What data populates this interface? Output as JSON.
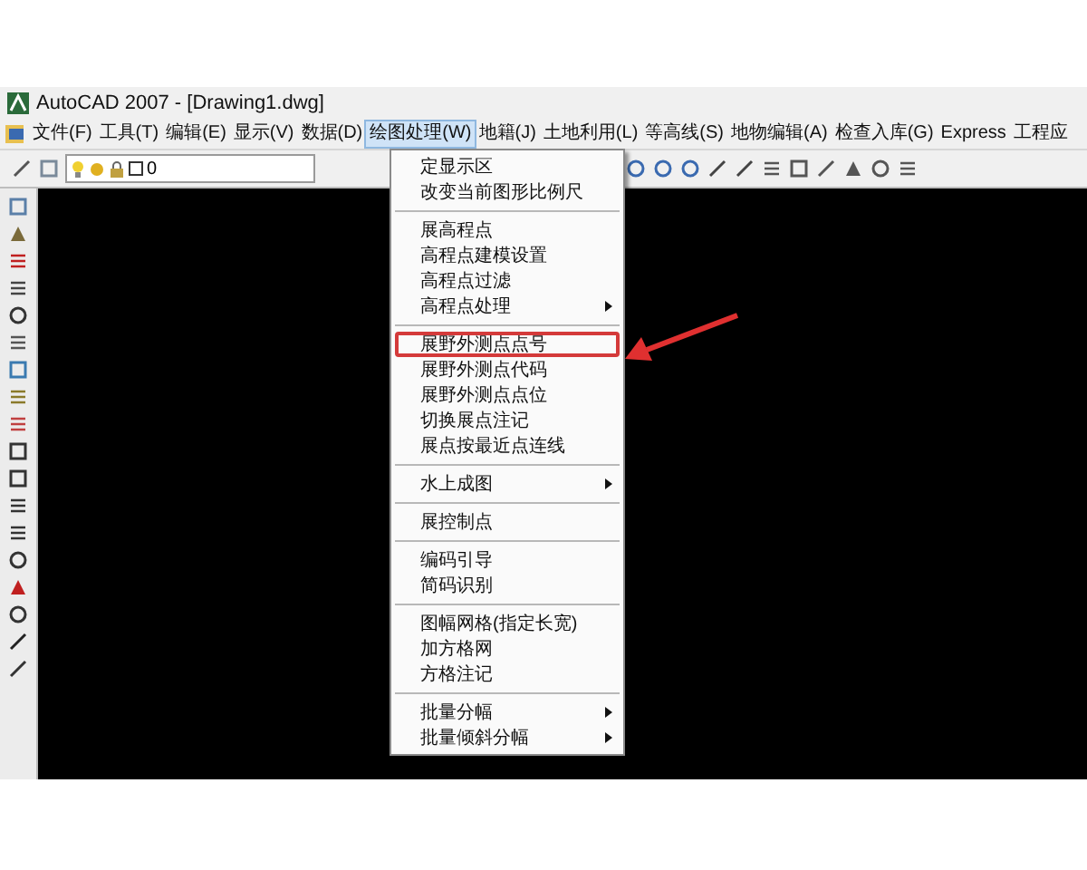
{
  "window": {
    "title": "AutoCAD 2007 - [Drawing1.dwg]"
  },
  "menu_bar": [
    {
      "label": "文件(F)",
      "selected": false
    },
    {
      "label": "工具(T)",
      "selected": false
    },
    {
      "label": "编辑(E)",
      "selected": false
    },
    {
      "label": "显示(V)",
      "selected": false
    },
    {
      "label": "数据(D)",
      "selected": false
    },
    {
      "label": "绘图处理(W)",
      "selected": true
    },
    {
      "label": "地籍(J)",
      "selected": false
    },
    {
      "label": "土地利用(L)",
      "selected": false
    },
    {
      "label": "等高线(S)",
      "selected": false
    },
    {
      "label": "地物编辑(A)",
      "selected": false
    },
    {
      "label": "检查入库(G)",
      "selected": false
    },
    {
      "label": "Express",
      "selected": false
    },
    {
      "label": "工程应",
      "selected": false
    }
  ],
  "layer_dropdown": {
    "value": "0"
  },
  "dropdown_menu": [
    {
      "kind": "item",
      "label": "定显示区",
      "submenu": false,
      "highlighted": false
    },
    {
      "kind": "item",
      "label": "改变当前图形比例尺",
      "submenu": false,
      "highlighted": false
    },
    {
      "kind": "separator"
    },
    {
      "kind": "item",
      "label": "展高程点",
      "submenu": false,
      "highlighted": false
    },
    {
      "kind": "item",
      "label": "高程点建模设置",
      "submenu": false,
      "highlighted": false
    },
    {
      "kind": "item",
      "label": "高程点过滤",
      "submenu": false,
      "highlighted": false
    },
    {
      "kind": "item",
      "label": "高程点处理",
      "submenu": true,
      "highlighted": false
    },
    {
      "kind": "separator"
    },
    {
      "kind": "item",
      "label": "展野外测点点号",
      "submenu": false,
      "highlighted": true
    },
    {
      "kind": "item",
      "label": "展野外测点代码",
      "submenu": false,
      "highlighted": false
    },
    {
      "kind": "item",
      "label": "展野外测点点位",
      "submenu": false,
      "highlighted": false
    },
    {
      "kind": "item",
      "label": "切换展点注记",
      "submenu": false,
      "highlighted": false
    },
    {
      "kind": "item",
      "label": "展点按最近点连线",
      "submenu": false,
      "highlighted": false
    },
    {
      "kind": "separator"
    },
    {
      "kind": "item",
      "label": "水上成图",
      "submenu": true,
      "highlighted": false
    },
    {
      "kind": "separator"
    },
    {
      "kind": "item",
      "label": "展控制点",
      "submenu": false,
      "highlighted": false
    },
    {
      "kind": "separator"
    },
    {
      "kind": "item",
      "label": "编码引导",
      "submenu": false,
      "highlighted": false
    },
    {
      "kind": "item",
      "label": "简码识别",
      "submenu": false,
      "highlighted": false
    },
    {
      "kind": "separator"
    },
    {
      "kind": "item",
      "label": "图幅网格(指定长宽)",
      "submenu": false,
      "highlighted": false
    },
    {
      "kind": "item",
      "label": "加方格网",
      "submenu": false,
      "highlighted": false
    },
    {
      "kind": "item",
      "label": "方格注记",
      "submenu": false,
      "highlighted": false
    },
    {
      "kind": "separator"
    },
    {
      "kind": "item",
      "label": "批量分幅",
      "submenu": true,
      "highlighted": false
    },
    {
      "kind": "item",
      "label": "批量倾斜分幅",
      "submenu": true,
      "highlighted": false
    }
  ]
}
